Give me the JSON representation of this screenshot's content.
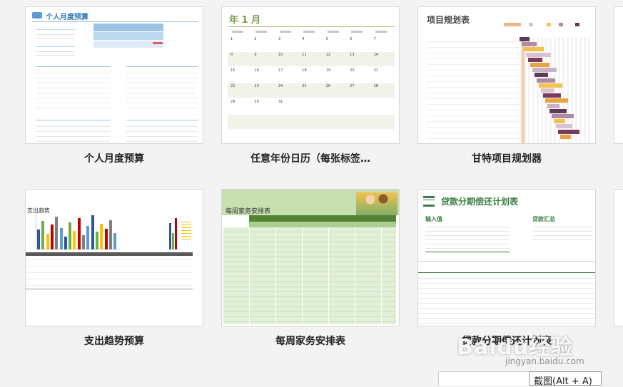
{
  "templates": [
    {
      "label": "个人月度预算",
      "preview_title": "个人月度预算"
    },
    {
      "label": "任意年份日历（每张标签…",
      "preview_title": "年 1 月",
      "calendar_days": [
        "1",
        "2",
        "3",
        "4",
        "5",
        "6",
        "7",
        "8",
        "9",
        "10",
        "11",
        "12",
        "13",
        "14",
        "15",
        "16",
        "17",
        "18",
        "19",
        "20",
        "21",
        "22",
        "23",
        "24",
        "25",
        "26",
        "27",
        "28",
        "29",
        "30",
        "31"
      ]
    },
    {
      "label": "甘特项目规划器",
      "preview_title": "项目规划表"
    },
    {
      "label": "支出趋势预算",
      "preview_title": "支出趋势"
    },
    {
      "label": "每周家务安排表",
      "preview_title": "每周家务安排表"
    },
    {
      "label": "贷款分期偿还计划表",
      "preview_title": "贷款分期偿还计划表",
      "section_input": "输入值",
      "section_summary": "贷款汇总"
    }
  ],
  "tooltip": {
    "text": "截图(Alt + A)"
  },
  "watermark": {
    "text": "Baidu经验",
    "sub": "jingyan.baidu.com"
  },
  "colors": {
    "budget": "#2e75b6",
    "calendar": "#7a9a4a",
    "gantt": "#7a3b5e",
    "chores": "#548235",
    "loan": "#3a7d44"
  }
}
